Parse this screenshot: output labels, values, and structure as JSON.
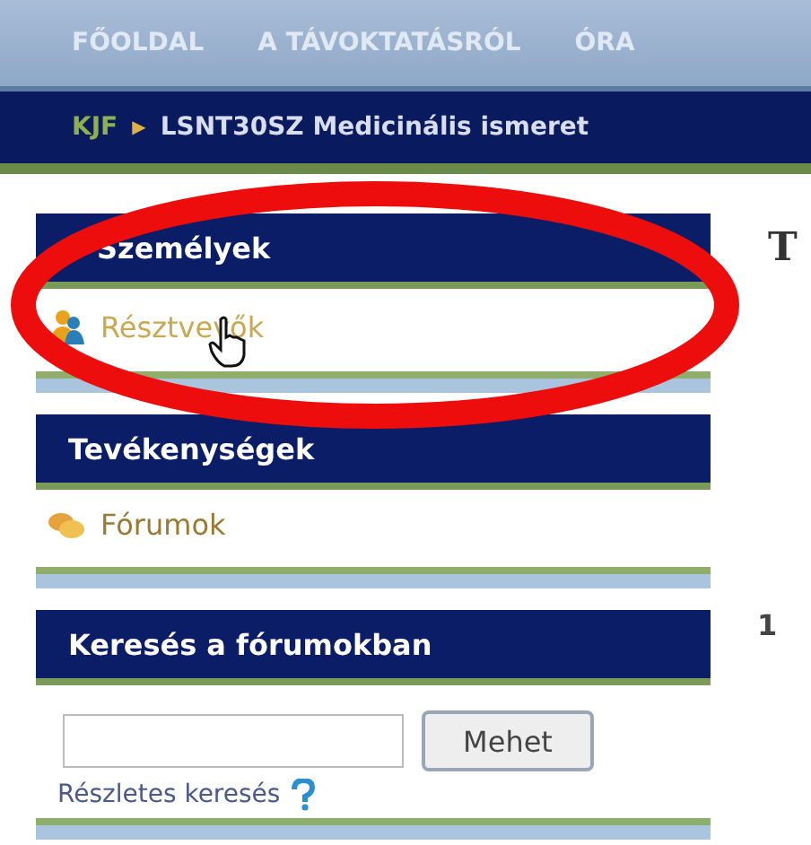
{
  "top_nav": [
    {
      "label": "FŐOLDAL"
    },
    {
      "label": "A TÁVOKTATÁSRÓL"
    },
    {
      "label": "ÓRA"
    }
  ],
  "breadcrumb": {
    "items": [
      "KJF",
      "LSNT30SZ Medicinális ismeret"
    ],
    "separator": "▶"
  },
  "blocks": [
    {
      "title": "Személyek",
      "kind": "links",
      "items": [
        {
          "label": "Résztvevők",
          "kind": "people",
          "hovered": true
        }
      ]
    },
    {
      "title": "Tevékenységek",
      "kind": "links",
      "items": [
        {
          "label": "Fórumok",
          "kind": "forum",
          "hovered": false
        }
      ]
    },
    {
      "title": "Keresés a fórumokban",
      "kind": "search",
      "button": "Mehet",
      "link": "Részletes keresés"
    }
  ],
  "main": {
    "column_1": "T",
    "column_2": "1"
  },
  "annotation": {
    "kind": "ellipse"
  }
}
